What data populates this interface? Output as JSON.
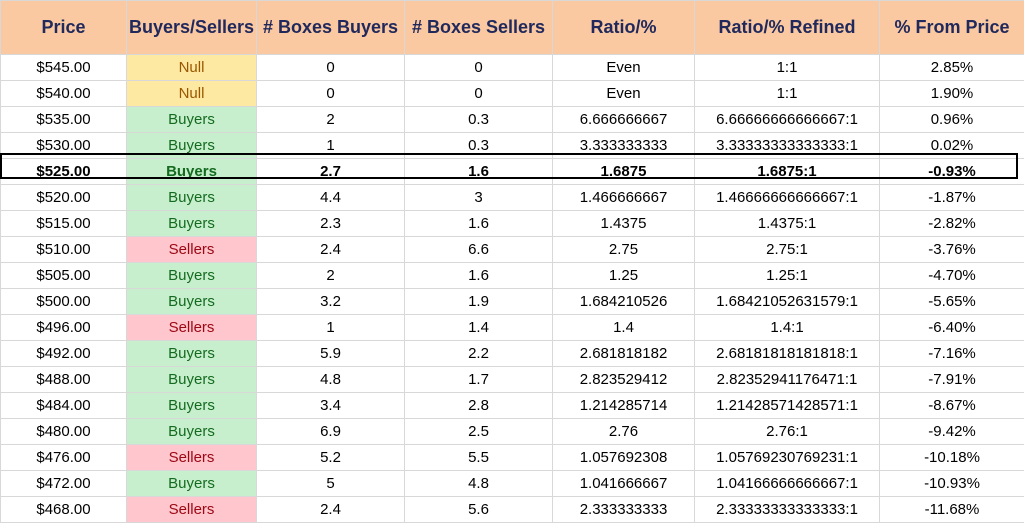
{
  "headers": [
    "Price",
    "Buyers/Sellers",
    "# Boxes Buyers",
    "# Boxes Sellers",
    "Ratio/%",
    "Ratio/% Refined",
    "% From Price"
  ],
  "rows": [
    {
      "price": "$545.00",
      "side": "Null",
      "buyers": "0",
      "sellers": "0",
      "ratio": "Even",
      "refined": "1:1",
      "from_price": "2.85%"
    },
    {
      "price": "$540.00",
      "side": "Null",
      "buyers": "0",
      "sellers": "0",
      "ratio": "Even",
      "refined": "1:1",
      "from_price": "1.90%"
    },
    {
      "price": "$535.00",
      "side": "Buyers",
      "buyers": "2",
      "sellers": "0.3",
      "ratio": "6.666666667",
      "refined": "6.66666666666667:1",
      "from_price": "0.96%"
    },
    {
      "price": "$530.00",
      "side": "Buyers",
      "buyers": "1",
      "sellers": "0.3",
      "ratio": "3.333333333",
      "refined": "3.33333333333333:1",
      "from_price": "0.02%"
    },
    {
      "price": "$525.00",
      "side": "Buyers",
      "buyers": "2.7",
      "sellers": "1.6",
      "ratio": "1.6875",
      "refined": "1.6875:1",
      "from_price": "-0.93%"
    },
    {
      "price": "$520.00",
      "side": "Buyers",
      "buyers": "4.4",
      "sellers": "3",
      "ratio": "1.466666667",
      "refined": "1.46666666666667:1",
      "from_price": "-1.87%"
    },
    {
      "price": "$515.00",
      "side": "Buyers",
      "buyers": "2.3",
      "sellers": "1.6",
      "ratio": "1.4375",
      "refined": "1.4375:1",
      "from_price": "-2.82%"
    },
    {
      "price": "$510.00",
      "side": "Sellers",
      "buyers": "2.4",
      "sellers": "6.6",
      "ratio": "2.75",
      "refined": "2.75:1",
      "from_price": "-3.76%"
    },
    {
      "price": "$505.00",
      "side": "Buyers",
      "buyers": "2",
      "sellers": "1.6",
      "ratio": "1.25",
      "refined": "1.25:1",
      "from_price": "-4.70%"
    },
    {
      "price": "$500.00",
      "side": "Buyers",
      "buyers": "3.2",
      "sellers": "1.9",
      "ratio": "1.684210526",
      "refined": "1.68421052631579:1",
      "from_price": "-5.65%"
    },
    {
      "price": "$496.00",
      "side": "Sellers",
      "buyers": "1",
      "sellers": "1.4",
      "ratio": "1.4",
      "refined": "1.4:1",
      "from_price": "-6.40%"
    },
    {
      "price": "$492.00",
      "side": "Buyers",
      "buyers": "5.9",
      "sellers": "2.2",
      "ratio": "2.681818182",
      "refined": "2.68181818181818:1",
      "from_price": "-7.16%"
    },
    {
      "price": "$488.00",
      "side": "Buyers",
      "buyers": "4.8",
      "sellers": "1.7",
      "ratio": "2.823529412",
      "refined": "2.82352941176471:1",
      "from_price": "-7.91%"
    },
    {
      "price": "$484.00",
      "side": "Buyers",
      "buyers": "3.4",
      "sellers": "2.8",
      "ratio": "1.214285714",
      "refined": "1.21428571428571:1",
      "from_price": "-8.67%"
    },
    {
      "price": "$480.00",
      "side": "Buyers",
      "buyers": "6.9",
      "sellers": "2.5",
      "ratio": "2.76",
      "refined": "2.76:1",
      "from_price": "-9.42%"
    },
    {
      "price": "$476.00",
      "side": "Sellers",
      "buyers": "5.2",
      "sellers": "5.5",
      "ratio": "1.057692308",
      "refined": "1.05769230769231:1",
      "from_price": "-10.18%"
    },
    {
      "price": "$472.00",
      "side": "Buyers",
      "buyers": "5",
      "sellers": "4.8",
      "ratio": "1.041666667",
      "refined": "1.04166666666667:1",
      "from_price": "-10.93%"
    },
    {
      "price": "$468.00",
      "side": "Sellers",
      "buyers": "2.4",
      "sellers": "5.6",
      "ratio": "2.333333333",
      "refined": "2.33333333333333:1",
      "from_price": "-11.68%"
    }
  ],
  "highlight_row_index": 4,
  "colors": {
    "header_bg": "#fac9a1",
    "header_text": "#21295c",
    "null_bg": "#fde9a2",
    "buyers_bg": "#c7eecd",
    "sellers_bg": "#ffc6cd"
  }
}
